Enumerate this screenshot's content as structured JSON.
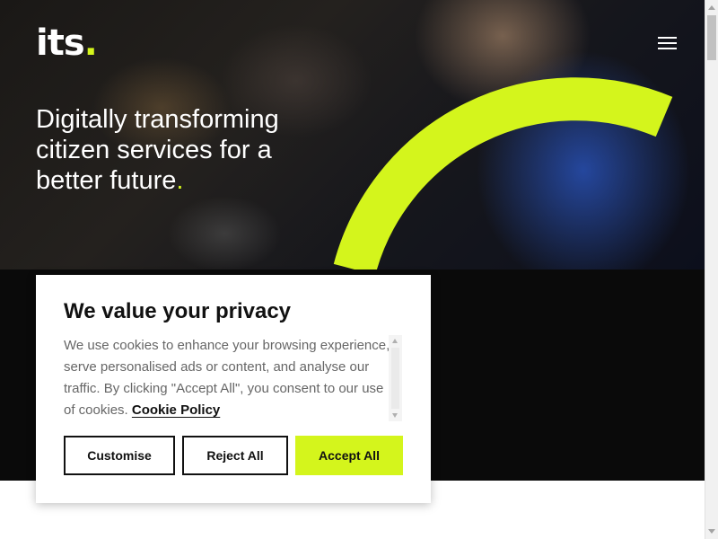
{
  "header": {
    "logo_text": "its",
    "logo_dot": ".",
    "menu_icon": "hamburger-menu-icon"
  },
  "hero": {
    "headline": "Digitally transforming citizen services for a better future",
    "headline_dot": "."
  },
  "cookie_banner": {
    "title": "We value your privacy",
    "body": "We use cookies to enhance your browsing experience, serve personalised ads or content, and analyse our traffic. By clicking \"Accept All\", you consent to our use of cookies.",
    "policy_link": "Cookie Policy",
    "customise_label": "Customise",
    "reject_label": "Reject All",
    "accept_label": "Accept All"
  },
  "colors": {
    "accent": "#d4f51c",
    "dark": "#0a0a0a",
    "text_muted": "#666666"
  }
}
